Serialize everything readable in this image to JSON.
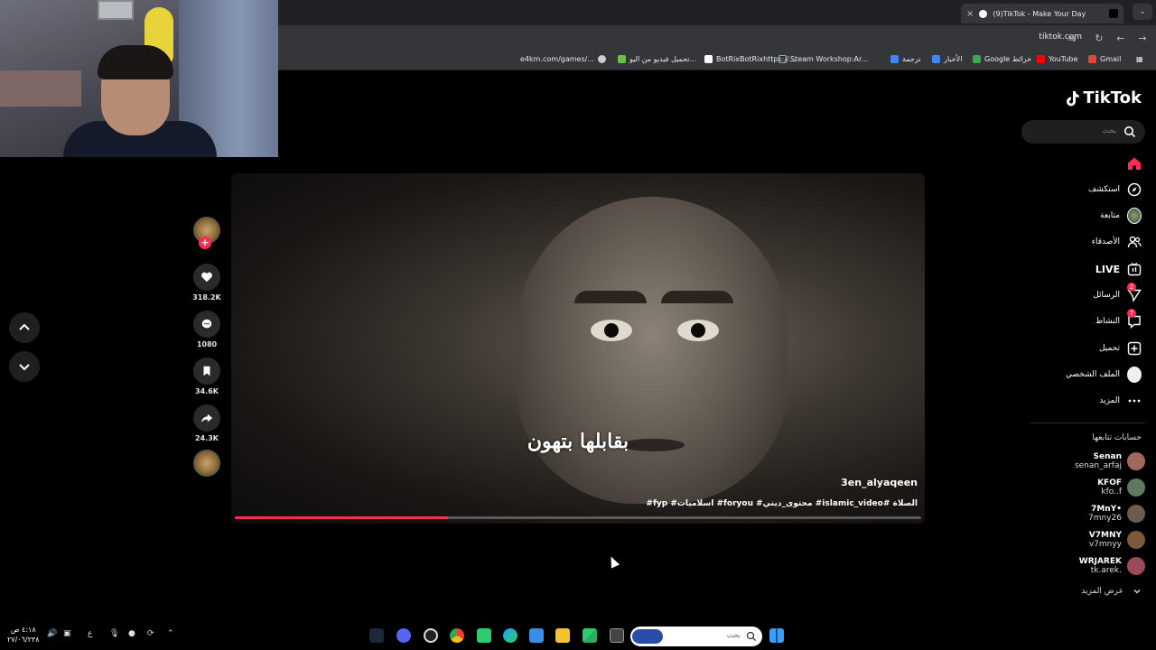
{
  "browser": {
    "tab_title": "(9)TikTok - Make Your Day",
    "new_tab": "+",
    "close": "×",
    "url": "tiktok.com",
    "bookmarks": [
      {
        "label": "Gmail",
        "color": "#ea4335"
      },
      {
        "label": "YouTube",
        "color": "#ff0000"
      },
      {
        "label": "Google خرائط",
        "color": "#34a853"
      },
      {
        "label": "الأخبار",
        "color": "#4285f4"
      },
      {
        "label": "ترجمة",
        "color": "#4285f4"
      },
      {
        "label": "Steam Workshop:Ar...",
        "color": "#1b2838"
      },
      {
        "label": "BotRixBotRixhttps://...",
        "color": "#ffffff"
      },
      {
        "label": "تحميل فيديو من اليو...",
        "color": "#6abf4b"
      },
      {
        "label": "e4km.com/games/...",
        "color": "#cccccc"
      }
    ]
  },
  "tiktok": {
    "logo": "TikTok",
    "search_placeholder": "بحث",
    "menu": [
      {
        "label": "",
        "icon": "home-icon",
        "active": true
      },
      {
        "label": "استكشف",
        "icon": "compass-icon"
      },
      {
        "label": "متابعة",
        "icon": "following-avatar"
      },
      {
        "label": "الأصدقاء",
        "icon": "friends-icon"
      },
      {
        "label": "LIVE",
        "icon": "live-icon"
      },
      {
        "label": "الرسائل",
        "icon": "messages-icon",
        "badge": "2"
      },
      {
        "label": "النشاط",
        "icon": "activity-icon",
        "badge": "7"
      },
      {
        "label": "تحميل",
        "icon": "upload-icon"
      },
      {
        "label": "الملف الشخصي",
        "icon": "profile-avatar"
      },
      {
        "label": "المزيد",
        "icon": "more-icon"
      }
    ],
    "following_title": "حسابات تتابعها",
    "accounts": [
      {
        "name": "Senan",
        "handle": "senan_arfaj",
        "color": "#a06a5a"
      },
      {
        "name": "KFOF",
        "handle": "kfo..f",
        "color": "#5d7a60"
      },
      {
        "name": "7MnY•",
        "handle": "7mny26",
        "color": "#6b5b50"
      },
      {
        "name": "V7MNY",
        "handle": "v7mnyy",
        "color": "#7a5a3a"
      },
      {
        "name": "WRJAREK",
        "handle": "tk.arek.",
        "color": "#9a4a5a"
      }
    ],
    "see_more": "عرض المزيد"
  },
  "video": {
    "subtitle": "بقابلها بتهون",
    "author": "3en_alyaqeen",
    "caption": "الصلاة #islamic_video# محتوى_ديني# foryou# اسلاميات# fyp#",
    "progress": 0.31,
    "likes": "318.2K",
    "comments": "1080",
    "saves": "34.6K",
    "shares": "24.3K"
  },
  "taskbar": {
    "search_placeholder": "بحث",
    "lang": "ع",
    "clock_time": "٤:١٨ ص",
    "clock_date": "٢٧/٠٦/٢٣٨"
  }
}
